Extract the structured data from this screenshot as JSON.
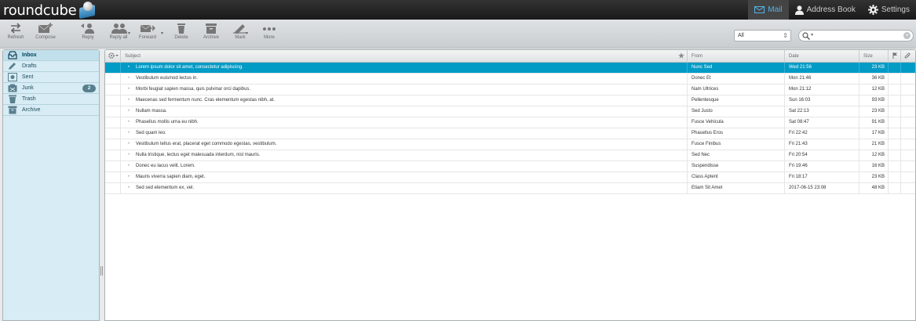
{
  "app": {
    "logo_text": "roundcube"
  },
  "topnav": {
    "mail": "Mail",
    "address_book": "Address Book",
    "settings": "Settings"
  },
  "toolbar": {
    "refresh": "Refresh",
    "compose": "Compose",
    "reply": "Reply",
    "reply_all": "Reply all",
    "forward": "Forward",
    "delete": "Delete",
    "archive": "Archive",
    "mark": "Mark",
    "more": "More"
  },
  "filter": {
    "selected": "All",
    "arrow": "⇕"
  },
  "search": {
    "reset": "×"
  },
  "folders": [
    {
      "name": "Inbox",
      "icon": "inbox-icon",
      "count": ""
    },
    {
      "name": "Drafts",
      "icon": "pencil-icon",
      "count": ""
    },
    {
      "name": "Sent",
      "icon": "sent-icon",
      "count": ""
    },
    {
      "name": "Junk",
      "icon": "junk-icon",
      "count": "2"
    },
    {
      "name": "Trash",
      "icon": "trash-icon",
      "count": ""
    },
    {
      "name": "Archive",
      "icon": "archive-icon",
      "count": ""
    }
  ],
  "list_header": {
    "subject": "Subject",
    "from": "From",
    "date": "Date",
    "size": "Size"
  },
  "messages": [
    {
      "subject": "Lorem ipsum dolor sit amet, consectetur adipiscing.",
      "from": "Nunc Sed",
      "date": "Wed 21:56",
      "size": "23 KB"
    },
    {
      "subject": "Vestibulum euismod lectus in.",
      "from": "Donec Et",
      "date": "Mon 21:46",
      "size": "36 KB"
    },
    {
      "subject": "Morbi feugiat sapien massa, quis pulvinar orci dapibus.",
      "from": "Nam Ultrices",
      "date": "Mon 21:12",
      "size": "12 KB"
    },
    {
      "subject": "Maecenas sed fermentum nunc. Cras elementum egestas nibh, at.",
      "from": "Pellentesque",
      "date": "Sun 16:03",
      "size": "93 KB"
    },
    {
      "subject": "Nullam massa.",
      "from": "Sed Justo",
      "date": "Sat 22:13",
      "size": "23 KB"
    },
    {
      "subject": "Phasellus mollis urna eu nibh.",
      "from": "Fusce Vehicula",
      "date": "Sat 08:47",
      "size": "91 KB"
    },
    {
      "subject": "Sed quam leo.",
      "from": "Phasellus Eros",
      "date": "Fri 22:42",
      "size": "17 KB"
    },
    {
      "subject": "Vestibulum tellus erat, placerat eget commodo egestas, vestibulum.",
      "from": "Fusce Finibus",
      "date": "Fri 21:43",
      "size": "21 KB"
    },
    {
      "subject": "Nulla tristique, lectus eget malesuada interdum, nisl mauris.",
      "from": "Sed Nec",
      "date": "Fri 20:54",
      "size": "12 KB"
    },
    {
      "subject": "Donec eu lacus velit. Lorem.",
      "from": "Suspendisse",
      "date": "Fri 19:46",
      "size": "16 KB"
    },
    {
      "subject": "Mauris viverra sapien diam, eget.",
      "from": "Class Aptent",
      "date": "Fri 18:17",
      "size": "23 KB"
    },
    {
      "subject": "Sed sed elementum ex, vel.",
      "from": "Etiam Sit Amet",
      "date": "2017-06-15 23:08",
      "size": "48 KB"
    }
  ],
  "colors": {
    "topbar": "#1a1a1a",
    "accent": "#55b2e6",
    "selected_row": "#019bc6",
    "folder_bg": "#d7ecf4"
  }
}
